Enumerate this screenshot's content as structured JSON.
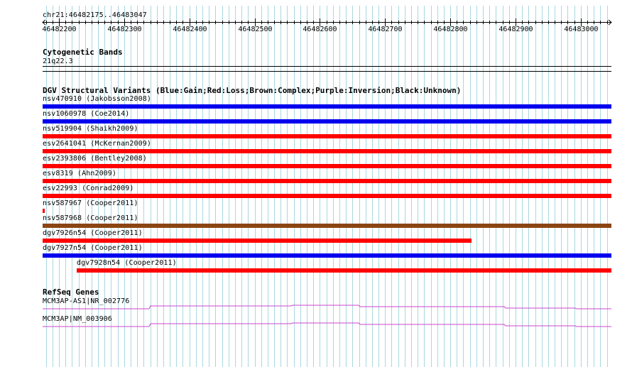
{
  "region": {
    "label": "chr21:46482175..46483047",
    "start": 46482175,
    "end": 46483047,
    "ticks": [
      46482200,
      46482300,
      46482400,
      46482500,
      46482600,
      46482700,
      46482800,
      46482900,
      46483000
    ],
    "tick_labels": [
      "46482200",
      "46482300",
      "46482400",
      "46482500",
      "46482600",
      "46482700",
      "46482800",
      "46482900",
      "46483000"
    ]
  },
  "cytoband_track": {
    "title": "Cytogenetic Bands",
    "band": "21q22.3"
  },
  "dgv_track": {
    "title": "DGV Structural Variants (Blue:Gain;Red:Loss;Brown:Complex;Purple:Inversion;Black:Unknown)",
    "variants": [
      {
        "label": "nsv470910 (Jakobsson2008)",
        "type": "Gain",
        "start": 46482175,
        "end": 46483047
      },
      {
        "label": "nsv1060978 (Coe2014)",
        "type": "Gain",
        "start": 46482175,
        "end": 46483047
      },
      {
        "label": "nsv519904 (Shaikh2009)",
        "type": "Loss",
        "start": 46482175,
        "end": 46483047
      },
      {
        "label": "esv2641041 (McKernan2009)",
        "type": "Loss",
        "start": 46482175,
        "end": 46483047
      },
      {
        "label": "esv2393806 (Bentley2008)",
        "type": "Loss",
        "start": 46482175,
        "end": 46483047
      },
      {
        "label": "esv8319 (Ahn2009)",
        "type": "Loss",
        "start": 46482175,
        "end": 46483047
      },
      {
        "label": "esv22993 (Conrad2009)",
        "type": "Loss",
        "start": 46482175,
        "end": 46483047
      },
      {
        "label": "nsv587967 (Cooper2011)",
        "type": "Loss",
        "start": 46482175,
        "end": 46482178
      },
      {
        "label": "nsv587968 (Cooper2011)",
        "type": "Complex",
        "start": 46482175,
        "end": 46483047
      },
      {
        "label": "dgv7926n54 (Cooper2011)",
        "type": "Loss",
        "start": 46482175,
        "end": 46482832
      },
      {
        "label": "dgv7927n54 (Cooper2011)",
        "type": "Gain",
        "start": 46482175,
        "end": 46483047
      },
      {
        "label": "dgv7928n54 (Cooper2011)",
        "type": "Loss",
        "start": 46482227,
        "end": 46483047
      }
    ]
  },
  "refseq_track": {
    "title": "RefSeq Genes",
    "genes": [
      {
        "label": "MCM3AP-AS1|NR_002776"
      },
      {
        "label": "MCM3AP|NM_003906"
      }
    ]
  },
  "colors": {
    "Gain": "#0000ee",
    "Loss": "#ff0000",
    "Complex": "#8b4513",
    "gridline": "#a8d8e0",
    "gene": "#cc44cc",
    "ruler": "#000000"
  }
}
